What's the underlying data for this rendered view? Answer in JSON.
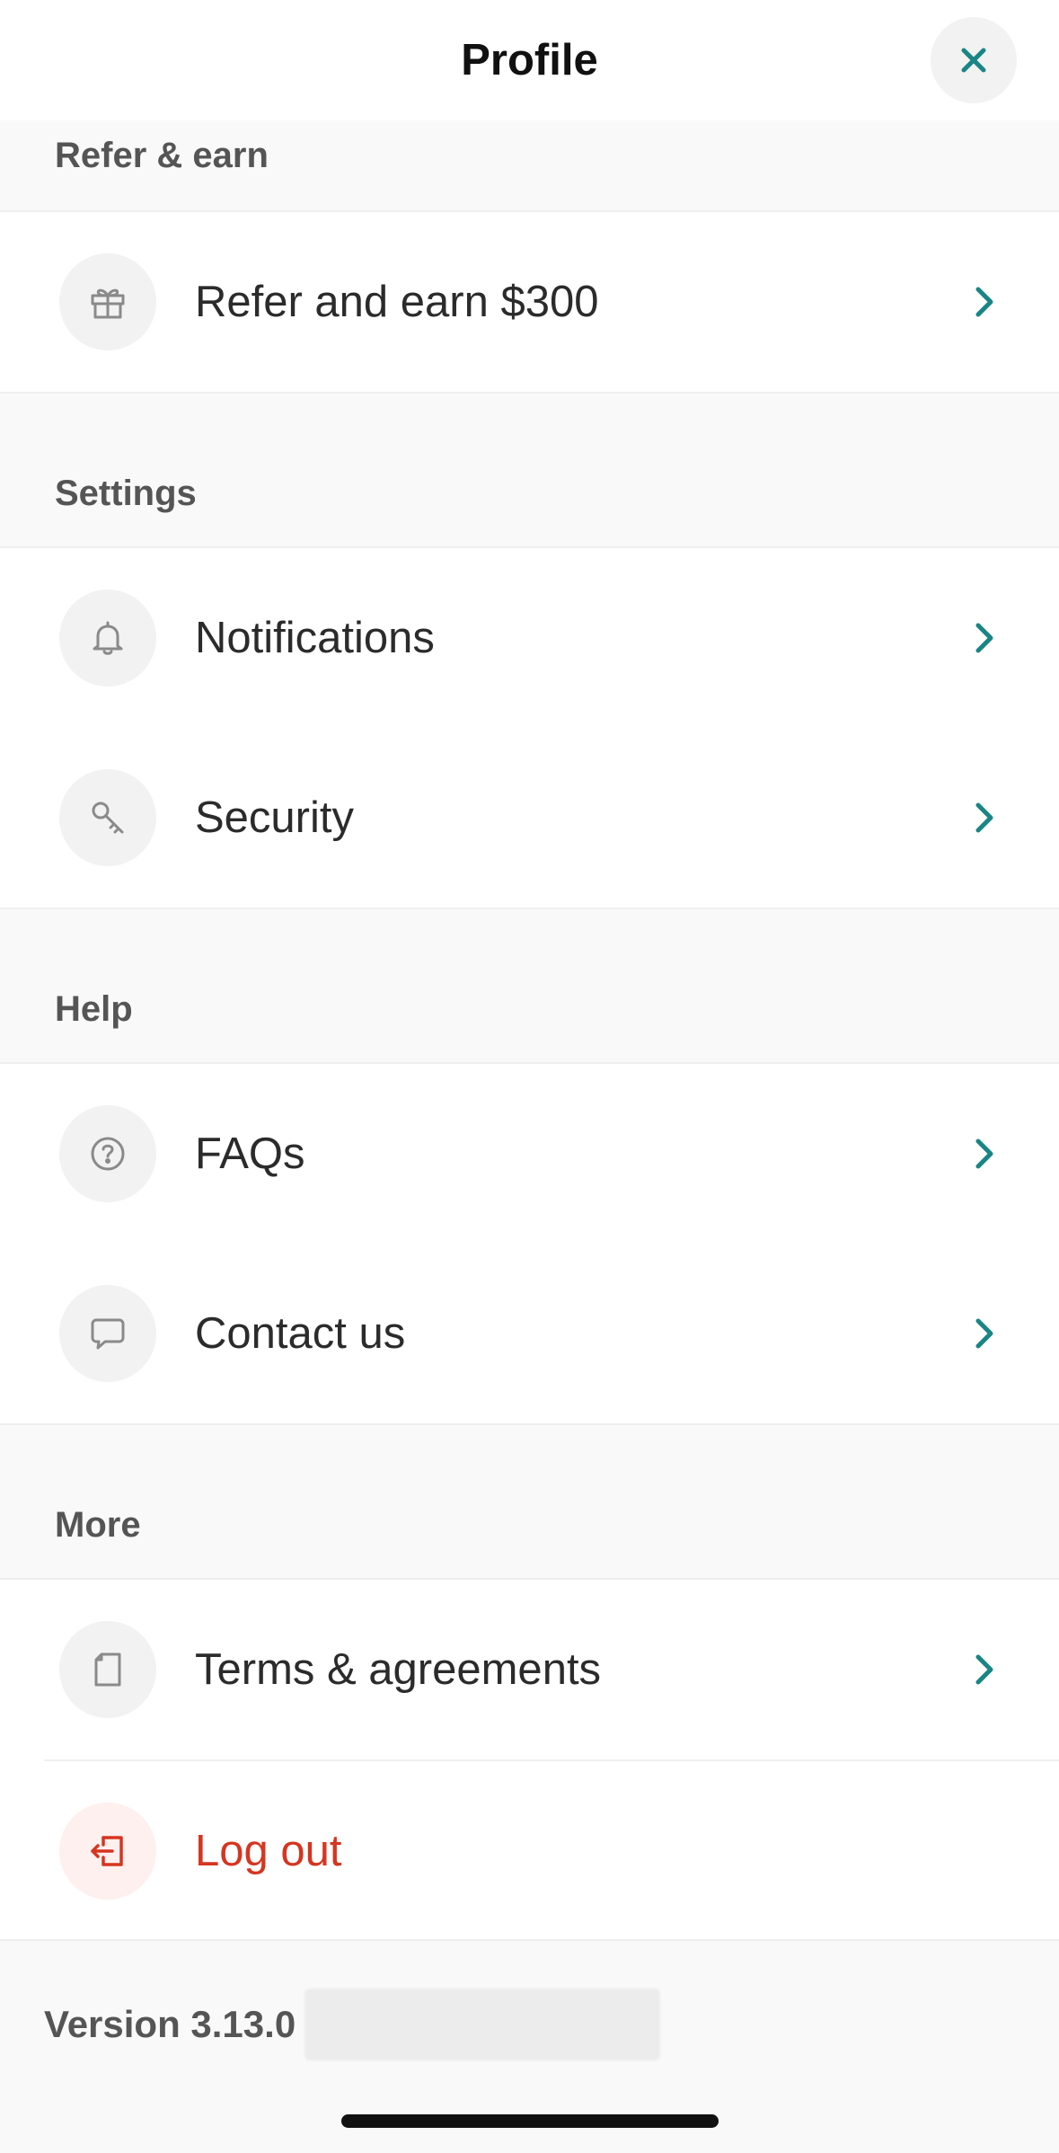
{
  "header": {
    "title": "Profile",
    "close_icon": "close-icon"
  },
  "sections": [
    {
      "title": "Refer & earn",
      "items": [
        {
          "label": "Refer and earn $300",
          "icon": "gift-icon"
        }
      ]
    },
    {
      "title": "Settings",
      "items": [
        {
          "label": "Notifications",
          "icon": "bell-icon"
        },
        {
          "label": "Security",
          "icon": "key-icon"
        }
      ]
    },
    {
      "title": "Help",
      "items": [
        {
          "label": "FAQs",
          "icon": "question-circle-icon"
        },
        {
          "label": "Contact us",
          "icon": "chat-bubble-icon"
        }
      ]
    },
    {
      "title": "More",
      "items": [
        {
          "label": "Terms & agreements",
          "icon": "document-icon"
        },
        {
          "label": "Log out",
          "icon": "logout-icon"
        }
      ]
    }
  ],
  "footer": {
    "version": "Version 3.13.0"
  },
  "colors": {
    "accent": "#1a8585",
    "danger": "#d6351f",
    "background": "#f9f9f9",
    "surface": "#ffffff"
  }
}
